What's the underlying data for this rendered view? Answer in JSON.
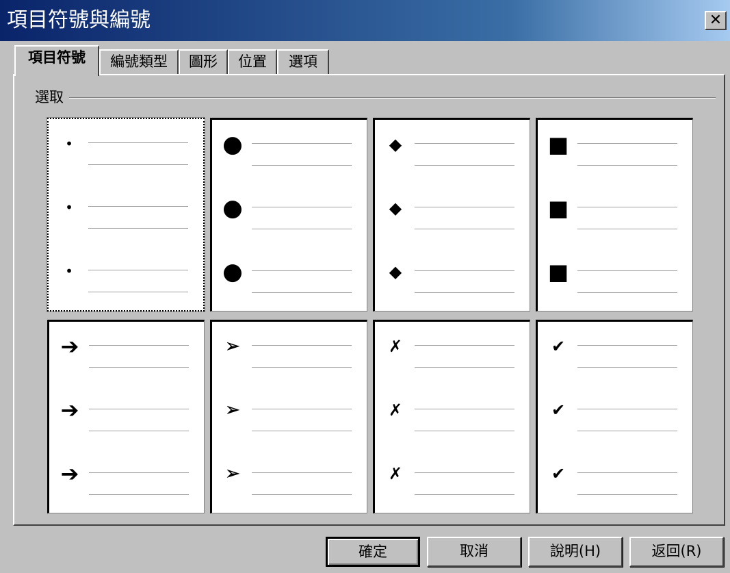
{
  "window": {
    "title": "項目符號與編號",
    "close_glyph": "✕"
  },
  "tabs": [
    {
      "label": "項目符號",
      "active": true
    },
    {
      "label": "編號類型",
      "active": false
    },
    {
      "label": "圖形",
      "active": false
    },
    {
      "label": "位置",
      "active": false
    },
    {
      "label": "選項",
      "active": false
    }
  ],
  "group": {
    "label": "選取"
  },
  "bullet_styles": [
    {
      "name": "small-dot",
      "glyph": "•",
      "selected": true
    },
    {
      "name": "large-dot",
      "glyph": "●",
      "selected": false
    },
    {
      "name": "diamond",
      "glyph": "◆",
      "selected": false
    },
    {
      "name": "square",
      "glyph": "■",
      "selected": false
    },
    {
      "name": "arrow",
      "glyph": "➔",
      "selected": false
    },
    {
      "name": "arrowhead",
      "glyph": "➢",
      "selected": false
    },
    {
      "name": "x-mark",
      "glyph": "✗",
      "selected": false
    },
    {
      "name": "check-mark",
      "glyph": "✔",
      "selected": false
    }
  ],
  "buttons": {
    "ok": "確定",
    "cancel": "取消",
    "help": "說明(H)",
    "reset": "返回(R)"
  }
}
